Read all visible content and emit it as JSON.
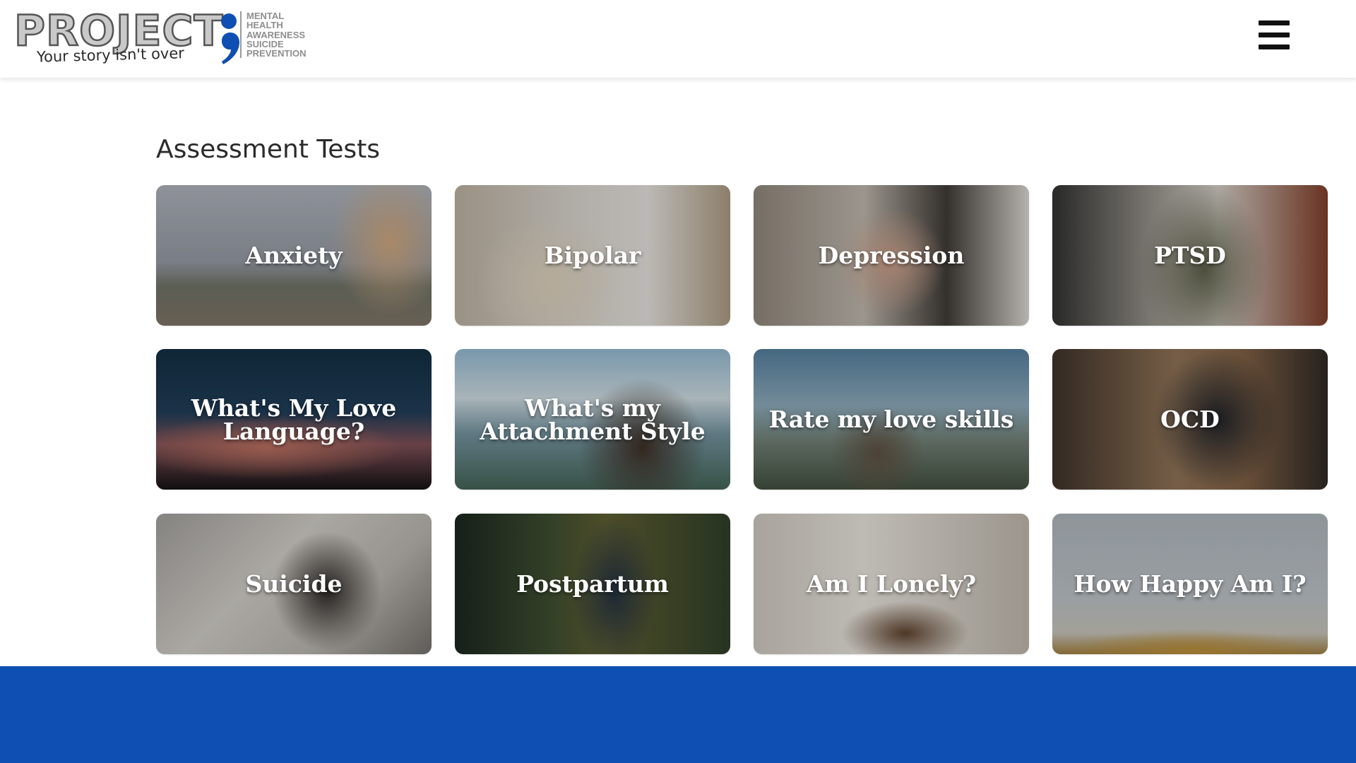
{
  "header": {
    "logo": {
      "word": "PROJECT",
      "tagline": "Your story isn't over",
      "stack": [
        "MENTAL",
        "HEALTH",
        "AWARENESS",
        "SUICIDE",
        "PREVENTION"
      ]
    },
    "menu_icon": "hamburger-menu-icon"
  },
  "main": {
    "title": "Assessment Tests",
    "cards": [
      {
        "label": "Anxiety"
      },
      {
        "label": "Bipolar"
      },
      {
        "label": "Depression"
      },
      {
        "label": "PTSD"
      },
      {
        "label": "What's My Love Language?"
      },
      {
        "label": "What's my Attachment Style"
      },
      {
        "label": "Rate my love skills"
      },
      {
        "label": "OCD"
      },
      {
        "label": "Suicide"
      },
      {
        "label": "Postpartum"
      },
      {
        "label": "Am I Lonely?"
      },
      {
        "label": "How Happy Am I?"
      }
    ]
  },
  "colors": {
    "brand_blue": "#0f4fb3",
    "logo_semicolon": "#0f4fb3",
    "text_dark": "#2b2b2b"
  }
}
